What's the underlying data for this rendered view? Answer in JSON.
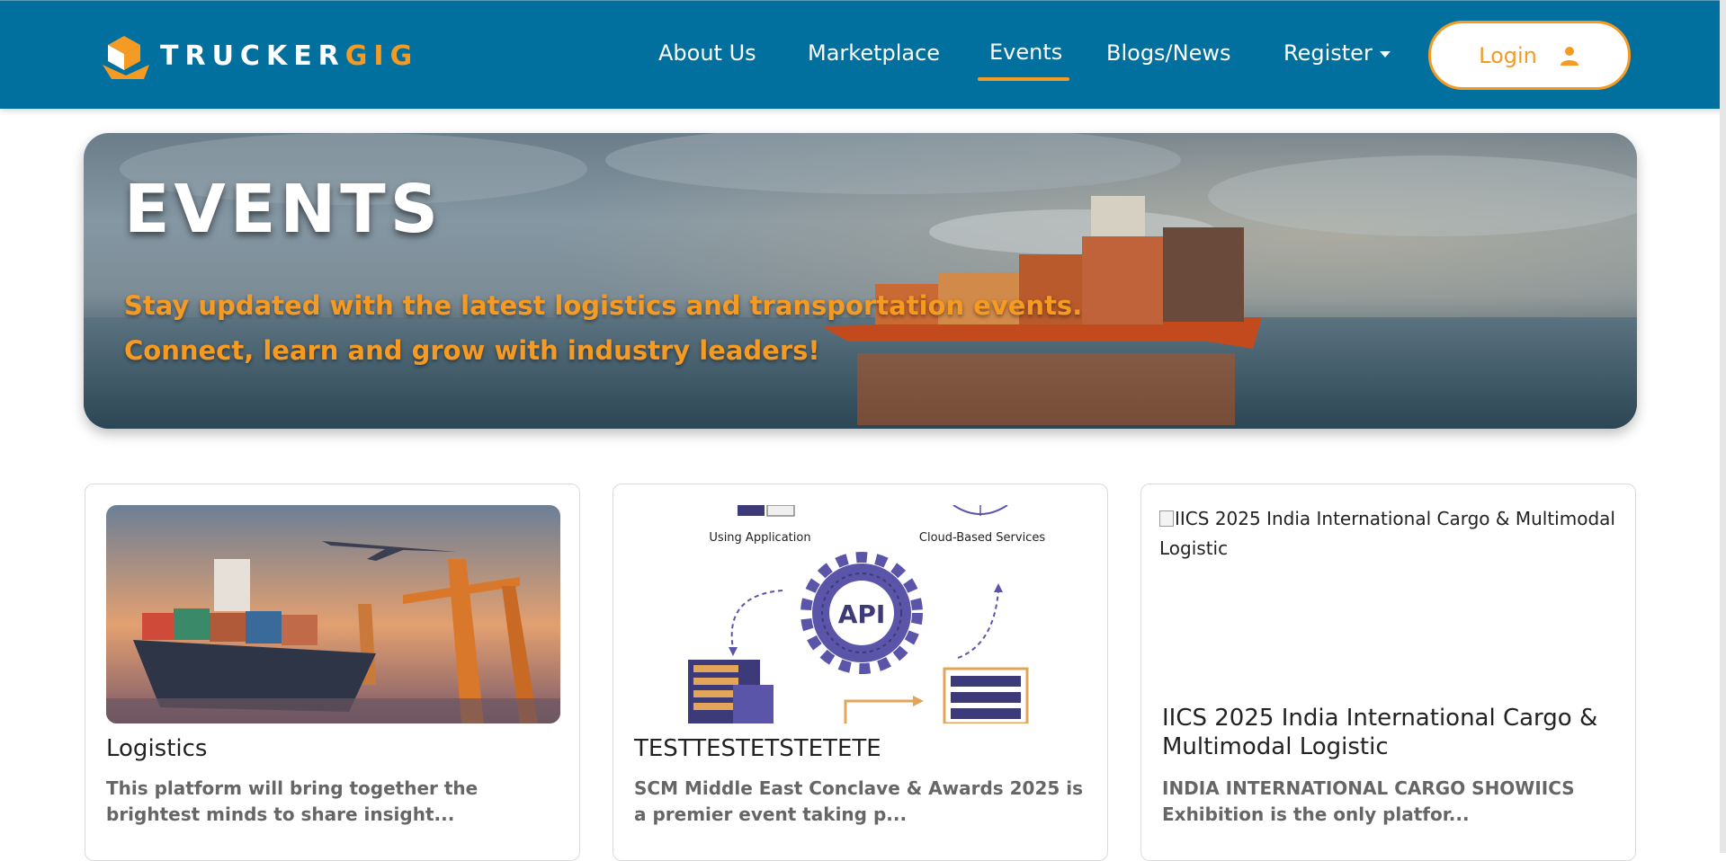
{
  "brand": {
    "name_part1": "TRUCKER",
    "name_part2": "GIG"
  },
  "nav": {
    "items": [
      {
        "label": "About Us"
      },
      {
        "label": "Marketplace"
      },
      {
        "label": "Events"
      },
      {
        "label": "Blogs/News"
      },
      {
        "label": "Register"
      }
    ],
    "active": "Events",
    "login_label": "Login"
  },
  "hero": {
    "title": "EVENTS",
    "subtitle_line1": "Stay updated with the latest logistics and transportation events.",
    "subtitle_line2": "Connect, learn and grow with industry leaders!"
  },
  "cards": [
    {
      "title": "Logistics",
      "description": "This platform will bring together the brightest minds to share insight..."
    },
    {
      "title": "TESTTESTETSTETETE",
      "description": "SCM Middle East Conclave & Awards 2025 is a premier event taking p...",
      "image_labels": {
        "left": "Using Application",
        "right": "Cloud-Based Services",
        "center": "API"
      }
    },
    {
      "image_alt": "IICS 2025 India International Cargo & Multimodal Logistic",
      "title": "IICS 2025 India International Cargo & Multimodal Logistic",
      "description": "INDIA INTERNATIONAL CARGO SHOWIICS Exhibition is the only platfor..."
    }
  ],
  "colors": {
    "header": "#01709e",
    "accent": "#f59a23",
    "api_purple": "#5a55a8"
  }
}
